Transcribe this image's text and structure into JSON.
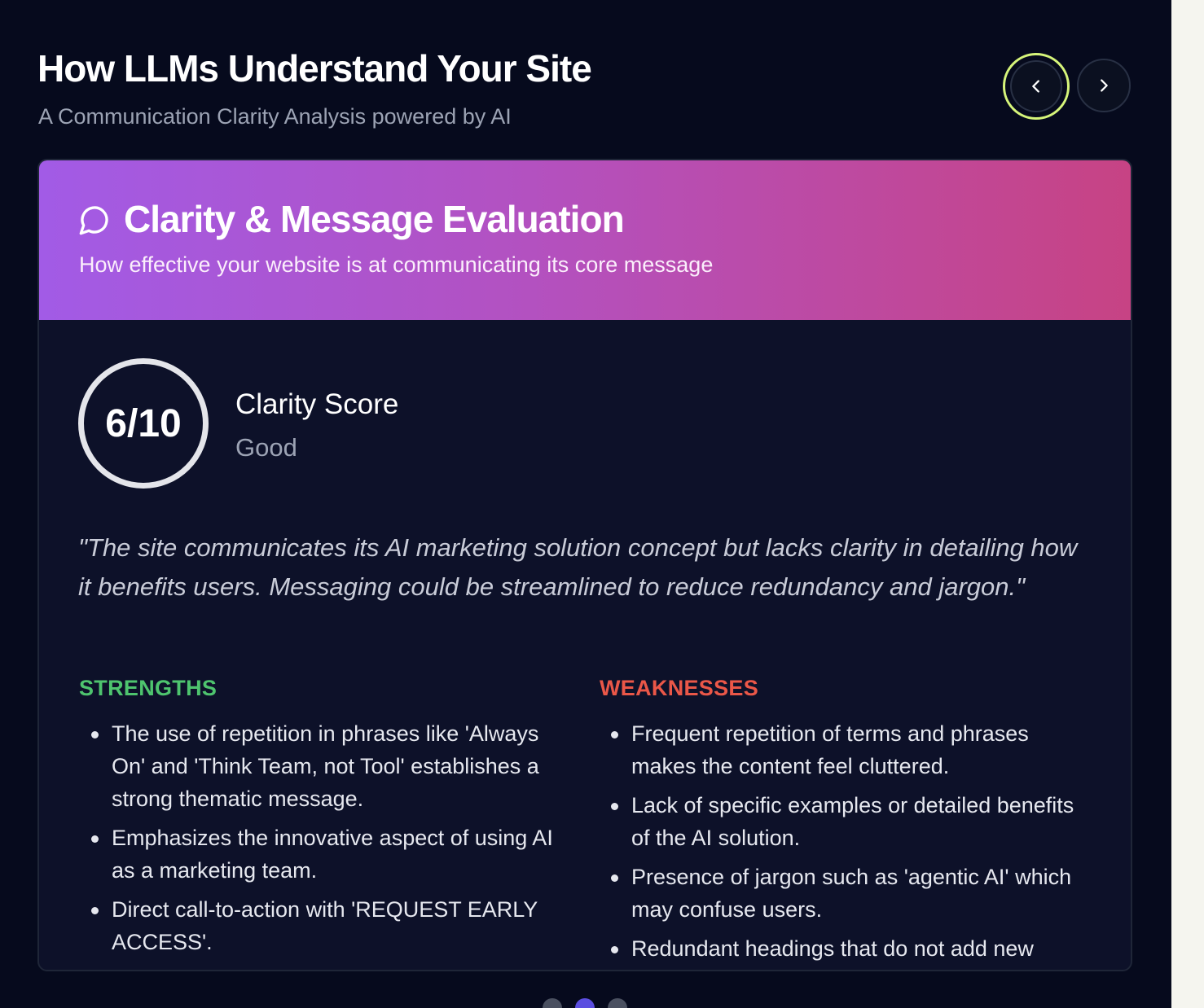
{
  "header": {
    "title": "How LLMs Understand Your Site",
    "subtitle": "A Communication Clarity Analysis powered by AI"
  },
  "nav": {
    "prev_icon": "chevron-left-icon",
    "next_icon": "chevron-right-icon"
  },
  "card": {
    "icon": "chat-bubble-icon",
    "title": "Clarity & Message Evaluation",
    "description": "How effective your website is at communicating its core message",
    "gradient_colors": [
      "#a25be6",
      "#c74384"
    ]
  },
  "score": {
    "value": "6/10",
    "label": "Clarity Score",
    "rating": "Good"
  },
  "quote": "\"The site communicates its AI marketing solution concept but lacks clarity in detailing how it benefits users. Messaging could be streamlined to reduce redundancy and jargon.\"",
  "strengths": {
    "heading": "STRENGTHS",
    "color": "#4ec46e",
    "items": [
      "The use of repetition in phrases like 'Always On' and 'Think Team, not Tool' establishes a strong thematic message.",
      "Emphasizes the innovative aspect of using AI as a marketing team.",
      "Direct call-to-action with 'REQUEST EARLY ACCESS'."
    ]
  },
  "weaknesses": {
    "heading": "WEAKNESSES",
    "color": "#ea5748",
    "items": [
      "Frequent repetition of terms and phrases makes the content feel cluttered.",
      "Lack of specific examples or detailed benefits of the AI solution.",
      "Presence of jargon such as 'agentic AI' which may confuse users.",
      "Redundant headings that do not add new information."
    ]
  },
  "pagination": {
    "total": 3,
    "active": 2,
    "active_color": "#5b4ee0"
  }
}
